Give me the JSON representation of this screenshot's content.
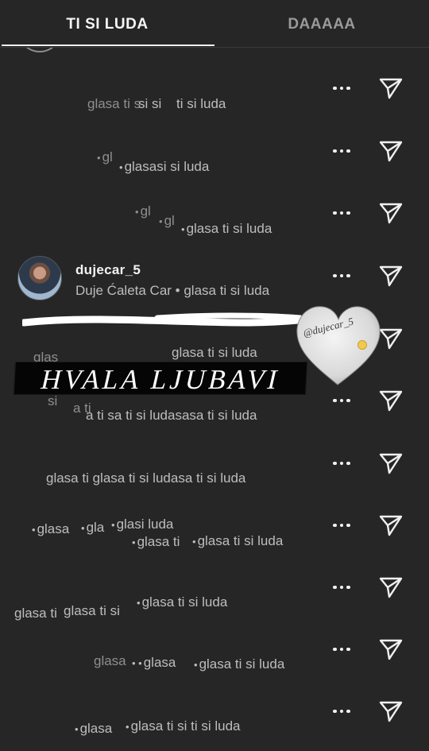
{
  "tabs": [
    {
      "label": "TI SI LUDA",
      "active": true
    },
    {
      "label": "DAAAAA",
      "active": false
    }
  ],
  "colors": {
    "background": "#262626",
    "text": "#bdbdbd",
    "accent": "#f2f2f2"
  },
  "rows": [
    {
      "ghosts": [
        {
          "b": "",
          "t": "glasa ti s",
          "dim": true
        },
        {
          "b": "",
          "t": "si si",
          "dim": false
        },
        {
          "b": "",
          "t": "ti si luda",
          "dim": false
        }
      ]
    },
    {
      "ghosts": [
        {
          "b": "•",
          "t": "gl",
          "dim": true
        },
        {
          "b": "•",
          "t": "glasasi si luda",
          "dim": false
        }
      ]
    },
    {
      "ghosts": [
        {
          "b": "•",
          "t": "gl",
          "dim": true
        },
        {
          "b": "•",
          "t": "gl",
          "dim": true
        },
        {
          "b": "•",
          "t": "glasa ti si luda",
          "dim": false
        }
      ]
    },
    {
      "profile": {
        "username": "dujecar_5",
        "subtitle": "Duje Ćaleta Car • glasa ti si luda"
      }
    },
    {
      "ghosts": [
        {
          "b": "",
          "t": "glas",
          "dim": true
        },
        {
          "b": "",
          "t": "glasa ti si luda",
          "dim": false
        }
      ]
    },
    {
      "ghosts": [
        {
          "b": "",
          "t": "si",
          "dim": true
        },
        {
          "b": "",
          "t": "a ti",
          "dim": true
        },
        {
          "b": "",
          "t": "a ti sa ti si ludasasa ti si luda",
          "dim": false
        }
      ]
    },
    {
      "ghosts": [
        {
          "b": "",
          "t": "glasa ti glasa ti si ludasa ti si luda",
          "dim": false
        }
      ]
    },
    {
      "ghosts": [
        {
          "b": "•",
          "t": "glasa",
          "dim": false
        },
        {
          "b": "•",
          "t": "gla",
          "dim": false
        },
        {
          "b": "•",
          "t": "glasi luda",
          "dim": false
        },
        {
          "b": "•",
          "t": "glasa ti",
          "dim": false
        },
        {
          "b": "•",
          "t": "glasa ti si luda",
          "dim": false
        }
      ]
    },
    {
      "ghosts": [
        {
          "b": "",
          "t": "glasa ti",
          "dim": false
        },
        {
          "b": "",
          "t": "glasa ti si",
          "dim": false
        },
        {
          "b": "•",
          "t": "glasa ti si luda",
          "dim": false
        }
      ]
    },
    {
      "ghosts": [
        {
          "b": "",
          "t": "glasa",
          "dim": true
        },
        {
          "b": "• •",
          "t": "glasa",
          "dim": false
        },
        {
          "b": "•",
          "t": "glasa ti si luda",
          "dim": false
        }
      ]
    },
    {
      "ghosts": [
        {
          "b": "•",
          "t": "glasa",
          "dim": false
        },
        {
          "b": "•",
          "t": "glasa ti si ti si luda",
          "dim": false
        }
      ]
    }
  ],
  "sticker": {
    "text": "HVALA LJUBAVI",
    "mention": "@dujecar_5"
  }
}
